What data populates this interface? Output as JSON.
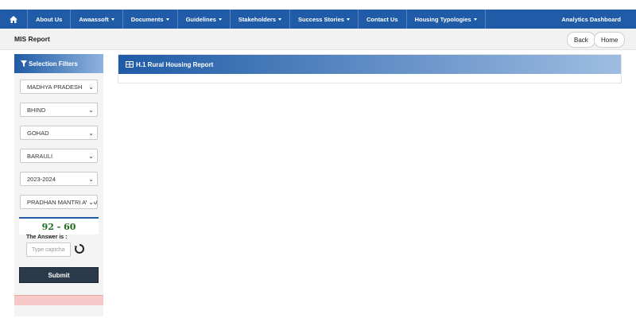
{
  "nav": {
    "home_icon": "home-icon",
    "items": [
      {
        "label": "About Us",
        "dropdown": false
      },
      {
        "label": "Awaassoft",
        "dropdown": true
      },
      {
        "label": "Documents",
        "dropdown": true
      },
      {
        "label": "Guidelines",
        "dropdown": true
      },
      {
        "label": "Stakeholders",
        "dropdown": true
      },
      {
        "label": "Success Stories",
        "dropdown": true
      },
      {
        "label": "Contact Us",
        "dropdown": false
      },
      {
        "label": "Housing Typologies",
        "dropdown": true
      }
    ],
    "right_link": "Analytics Dashboard"
  },
  "page": {
    "title": "MIS Report",
    "back_label": "Back",
    "home_label": "Home"
  },
  "filters": {
    "heading": "Selection Filters",
    "state": "MADHYA PRADESH",
    "district": "BHIND",
    "block": "GOHAD",
    "village": "BARAULI",
    "year": "2023-2024",
    "scheme": "PRADHAN MANTRI AWAAS YOJANA",
    "captcha_question": "92 - 60",
    "answer_label": "The Answer is :",
    "captcha_placeholder": "Type captcha",
    "submit_label": "Submit"
  },
  "report": {
    "title": "H.1 Rural Housing Report"
  },
  "colors": {
    "primary": "#1f5ba6",
    "submit_bg": "#2b3a4a",
    "captcha_text": "#1e6b1e"
  }
}
